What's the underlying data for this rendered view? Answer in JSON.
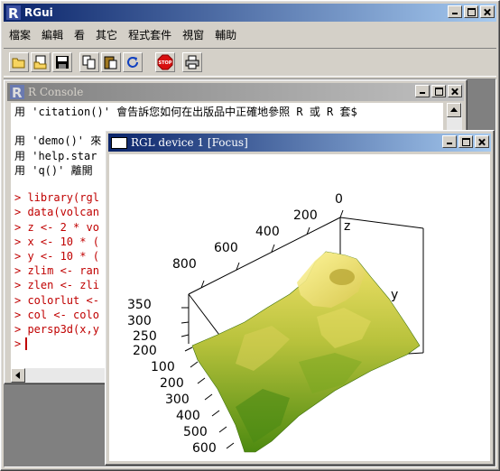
{
  "app": {
    "title": "RGui",
    "menu": [
      "檔案",
      "編輯",
      "看",
      "其它",
      "程式套件",
      "視窗",
      "輔助"
    ],
    "toolbar_icons": [
      "open-script-icon",
      "load-workspace-icon",
      "save-icon",
      "copy-icon",
      "paste-icon",
      "refresh-icon",
      "stop-icon",
      "print-icon"
    ],
    "stop_label": "STOP"
  },
  "console": {
    "title": "R Console",
    "lines": [
      {
        "text": "用 'citation()' 會告訴您如何在出版品中正確地參照 R 或 R 套$",
        "color": "black"
      },
      {
        "text": "",
        "color": "black"
      },
      {
        "text": "用 'demo()' 來",
        "color": "black"
      },
      {
        "text": "用 'help.star",
        "color": "black"
      },
      {
        "text": "用 'q()' 離開",
        "color": "black"
      },
      {
        "text": "",
        "color": "black"
      },
      {
        "text": "> library(rgl",
        "color": "red"
      },
      {
        "text": "> data(volcan",
        "color": "red"
      },
      {
        "text": "> z <- 2 * vo",
        "color": "red"
      },
      {
        "text": "> x <- 10 * (",
        "color": "red"
      },
      {
        "text": "> y <- 10 * (",
        "color": "red"
      },
      {
        "text": "> zlim <- ran",
        "color": "red"
      },
      {
        "text": "> zlen <- zli",
        "color": "red"
      },
      {
        "text": "> colorlut <-",
        "color": "red"
      },
      {
        "text": "> col <- colo",
        "color": "red"
      },
      {
        "text": "> persp3d(x,y",
        "color": "red"
      },
      {
        "text": "> ",
        "color": "red"
      }
    ]
  },
  "rgl": {
    "title": "RGL device 1 [Focus]",
    "z_label": "z",
    "y_label": "y",
    "top_ticks": [
      "0",
      "200",
      "400",
      "600",
      "800"
    ],
    "left_ticks": [
      "350",
      "300",
      "250",
      "200"
    ],
    "bottom_ticks": [
      "100",
      "200",
      "300",
      "400",
      "500",
      "600"
    ],
    "surface_colors": {
      "light": "#f2e26a",
      "mid": "#b8c23c",
      "dark": "#4d8a10"
    }
  }
}
